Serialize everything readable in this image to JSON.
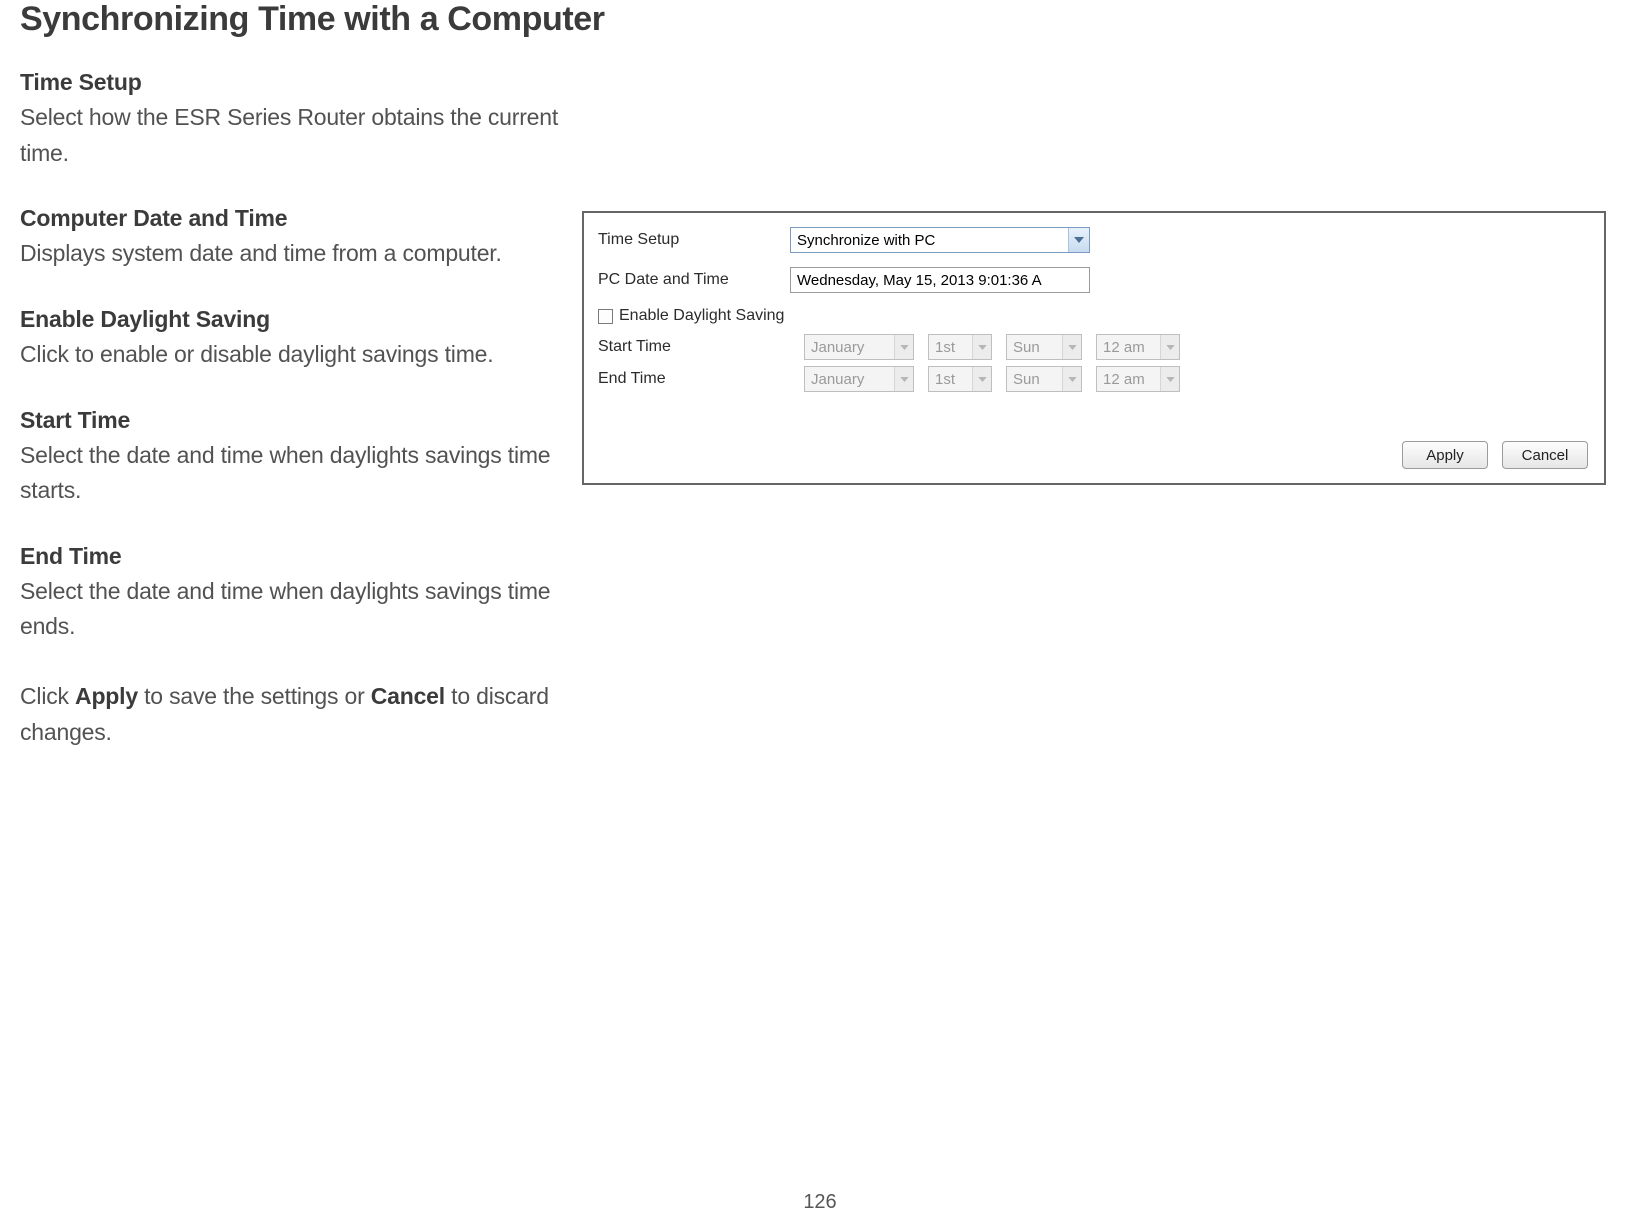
{
  "page_number": "126",
  "title": "Synchronizing Time with a Computer",
  "sections": {
    "time_setup": {
      "heading": "Time Setup",
      "text": "Select how the ESR Series Router obtains the current time."
    },
    "pc_date": {
      "heading": "Computer Date and Time",
      "text": "Displays system date and time from a computer."
    },
    "enable_ds": {
      "heading": "Enable Daylight Saving",
      "text": "Click to enable or disable daylight savings time."
    },
    "start_time": {
      "heading": "Start Time",
      "text": "Select the date and time when daylights savings time starts."
    },
    "end_time": {
      "heading": "End Time",
      "text": "Select the date and time when daylights savings time ends."
    }
  },
  "footer_line": {
    "pre": "Click ",
    "apply": "Apply",
    "mid": " to save the settings or ",
    "cancel": "Cancel",
    "post": " to discard changes."
  },
  "panel": {
    "labels": {
      "time_setup": "Time Setup",
      "pc_date": "PC Date and Time",
      "enable_ds": "Enable Daylight Saving",
      "start_time": "Start Time",
      "end_time": "End Time"
    },
    "values": {
      "time_setup_selected": "Synchronize with PC",
      "pc_date_value": "Wednesday, May 15, 2013 9:01:36 A"
    },
    "disabled_selects": {
      "month": "January",
      "week": "1st",
      "day": "Sun",
      "hour": "12 am"
    },
    "buttons": {
      "apply": "Apply",
      "cancel": "Cancel"
    }
  }
}
